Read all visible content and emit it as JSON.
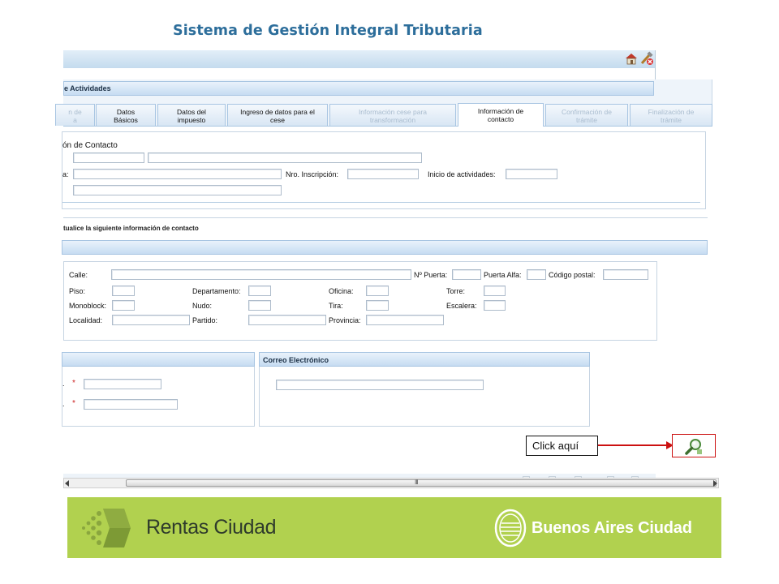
{
  "header": {
    "title": "Sistema de Gestión Integral Tributaria"
  },
  "section": {
    "title": "e Actividades"
  },
  "tabs": [
    {
      "label": "n de\na",
      "state": "disabled"
    },
    {
      "label": "Datos\nBásicos",
      "state": "enabled"
    },
    {
      "label": "Datos del\nimpuesto",
      "state": "enabled"
    },
    {
      "label": "Ingreso de datos para el\ncese",
      "state": "enabled"
    },
    {
      "label": "Información cese para\ntransformación",
      "state": "disabled"
    },
    {
      "label": "Información de\ncontacto",
      "state": "active"
    },
    {
      "label": "Confirmación de\ntrámite",
      "state": "disabled"
    },
    {
      "label": "Finalización de\ntrámite",
      "state": "disabled"
    }
  ],
  "contact_info": {
    "title": "ón de Contacto",
    "razon_label": "a:",
    "nro_inscripcion_label": "Nro. Inscripción:",
    "inicio_actividades_label": "Inicio de actividades:"
  },
  "instruction": "tualice la siguiente información de contacto",
  "address": {
    "calle_label": "Calle:",
    "nro_puerta_label": "Nº Puerta:",
    "puerta_alfa_label": "Puerta Alfa:",
    "codigo_postal_label": "Código postal:",
    "piso_label": "Piso:",
    "departamento_label": "Departamento:",
    "oficina_label": "Oficina:",
    "torre_label": "Torre:",
    "monoblock_label": "Monoblock:",
    "nudo_label": "Nudo:",
    "tira_label": "Tira:",
    "escalera_label": "Escalera:",
    "localidad_label": "Localidad:",
    "partido_label": "Partido:",
    "provincia_label": "Provincia:"
  },
  "phone": {
    "required_mark": "*"
  },
  "email": {
    "title": "Correo Electrónico"
  },
  "callout": {
    "text": "Click aquí"
  },
  "footer": {
    "brand": "Rentas Ciudad",
    "city": "Buenos Aires Ciudad"
  },
  "colors": {
    "title": "#2d6e9b",
    "footer_bg": "#b1d14f",
    "callout": "#cc1111"
  },
  "icons": [
    "home-icon",
    "tools-icon",
    "close-icon",
    "search-icon",
    "rentas-logo-icon",
    "city-seal-icon"
  ]
}
